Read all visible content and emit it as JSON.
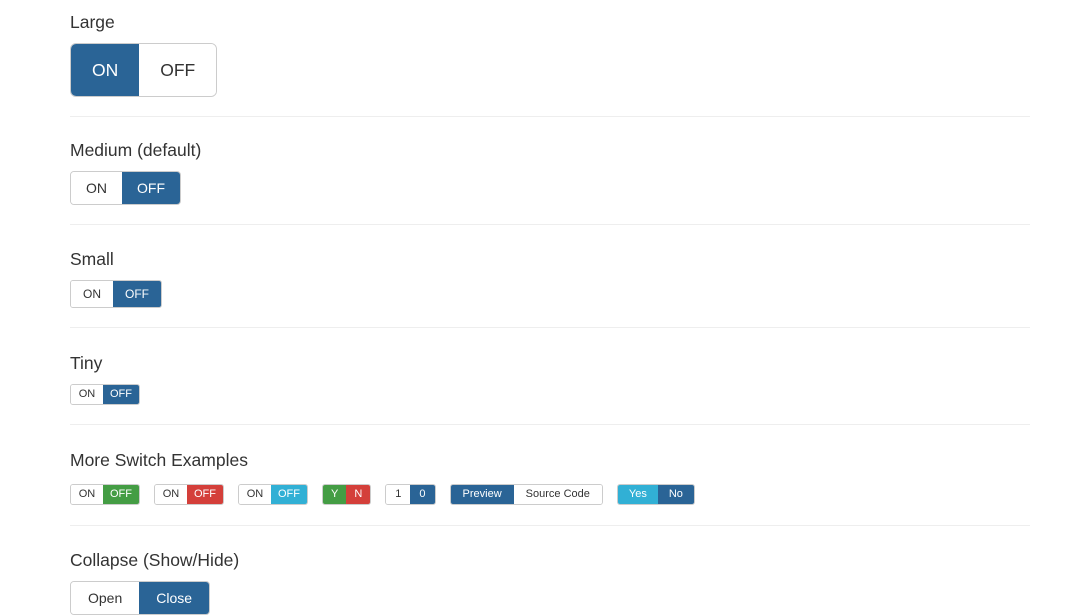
{
  "colors": {
    "primary": "#2a6496",
    "success": "#449d44",
    "danger": "#d43f3a",
    "info": "#31b0d5",
    "default_bg": "#ffffff",
    "text": "#333333",
    "border": "#cccccc",
    "divider": "#eeeeee"
  },
  "sections": {
    "large": {
      "title": "Large",
      "switch": {
        "on_label": "ON",
        "off_label": "OFF",
        "state": "on"
      }
    },
    "medium": {
      "title": "Medium (default)",
      "switch": {
        "on_label": "ON",
        "off_label": "OFF",
        "state": "off"
      }
    },
    "small": {
      "title": "Small",
      "switch": {
        "on_label": "ON",
        "off_label": "OFF",
        "state": "off"
      }
    },
    "tiny": {
      "title": "Tiny",
      "switch": {
        "on_label": "ON",
        "off_label": "OFF",
        "state": "off"
      }
    },
    "more": {
      "title": "More Switch Examples",
      "switches": [
        {
          "name": "success-switch",
          "on_label": "ON",
          "off_label": "OFF",
          "state": "off",
          "active_color": "#449d44"
        },
        {
          "name": "danger-switch",
          "on_label": "ON",
          "off_label": "OFF",
          "state": "off",
          "active_color": "#d43f3a"
        },
        {
          "name": "info-switch",
          "on_label": "ON",
          "off_label": "OFF",
          "state": "off",
          "active_color": "#31b0d5"
        },
        {
          "name": "yes-no-switch",
          "on_label": "Y",
          "off_label": "N",
          "state": "split",
          "on_color": "#449d44",
          "off_color": "#d43f3a"
        },
        {
          "name": "binary-switch",
          "on_label": "1",
          "off_label": "0",
          "state": "off",
          "active_color": "#2a6496"
        },
        {
          "name": "preview-switch",
          "on_label": "Preview",
          "off_label": "Source Code",
          "state": "on",
          "active_color": "#2a6496"
        },
        {
          "name": "yesno-switch",
          "on_label": "Yes",
          "off_label": "No",
          "state": "both",
          "on_color": "#31b0d5",
          "off_color": "#2a6496"
        }
      ]
    },
    "collapse": {
      "title": "Collapse (Show/Hide)",
      "switch": {
        "on_label": "Open",
        "off_label": "Close",
        "state": "off"
      }
    }
  }
}
